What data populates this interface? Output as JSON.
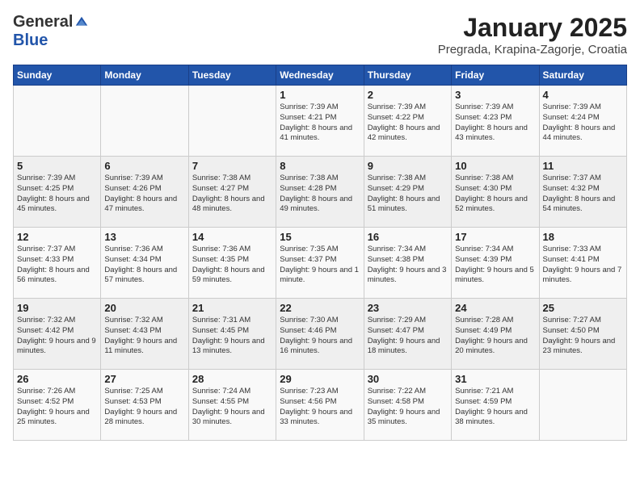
{
  "header": {
    "logo_general": "General",
    "logo_blue": "Blue",
    "month": "January 2025",
    "location": "Pregrada, Krapina-Zagorje, Croatia"
  },
  "days_of_week": [
    "Sunday",
    "Monday",
    "Tuesday",
    "Wednesday",
    "Thursday",
    "Friday",
    "Saturday"
  ],
  "weeks": [
    [
      {
        "day": "",
        "info": ""
      },
      {
        "day": "",
        "info": ""
      },
      {
        "day": "",
        "info": ""
      },
      {
        "day": "1",
        "info": "Sunrise: 7:39 AM\nSunset: 4:21 PM\nDaylight: 8 hours and 41 minutes."
      },
      {
        "day": "2",
        "info": "Sunrise: 7:39 AM\nSunset: 4:22 PM\nDaylight: 8 hours and 42 minutes."
      },
      {
        "day": "3",
        "info": "Sunrise: 7:39 AM\nSunset: 4:23 PM\nDaylight: 8 hours and 43 minutes."
      },
      {
        "day": "4",
        "info": "Sunrise: 7:39 AM\nSunset: 4:24 PM\nDaylight: 8 hours and 44 minutes."
      }
    ],
    [
      {
        "day": "5",
        "info": "Sunrise: 7:39 AM\nSunset: 4:25 PM\nDaylight: 8 hours and 45 minutes."
      },
      {
        "day": "6",
        "info": "Sunrise: 7:39 AM\nSunset: 4:26 PM\nDaylight: 8 hours and 47 minutes."
      },
      {
        "day": "7",
        "info": "Sunrise: 7:38 AM\nSunset: 4:27 PM\nDaylight: 8 hours and 48 minutes."
      },
      {
        "day": "8",
        "info": "Sunrise: 7:38 AM\nSunset: 4:28 PM\nDaylight: 8 hours and 49 minutes."
      },
      {
        "day": "9",
        "info": "Sunrise: 7:38 AM\nSunset: 4:29 PM\nDaylight: 8 hours and 51 minutes."
      },
      {
        "day": "10",
        "info": "Sunrise: 7:38 AM\nSunset: 4:30 PM\nDaylight: 8 hours and 52 minutes."
      },
      {
        "day": "11",
        "info": "Sunrise: 7:37 AM\nSunset: 4:32 PM\nDaylight: 8 hours and 54 minutes."
      }
    ],
    [
      {
        "day": "12",
        "info": "Sunrise: 7:37 AM\nSunset: 4:33 PM\nDaylight: 8 hours and 56 minutes."
      },
      {
        "day": "13",
        "info": "Sunrise: 7:36 AM\nSunset: 4:34 PM\nDaylight: 8 hours and 57 minutes."
      },
      {
        "day": "14",
        "info": "Sunrise: 7:36 AM\nSunset: 4:35 PM\nDaylight: 8 hours and 59 minutes."
      },
      {
        "day": "15",
        "info": "Sunrise: 7:35 AM\nSunset: 4:37 PM\nDaylight: 9 hours and 1 minute."
      },
      {
        "day": "16",
        "info": "Sunrise: 7:34 AM\nSunset: 4:38 PM\nDaylight: 9 hours and 3 minutes."
      },
      {
        "day": "17",
        "info": "Sunrise: 7:34 AM\nSunset: 4:39 PM\nDaylight: 9 hours and 5 minutes."
      },
      {
        "day": "18",
        "info": "Sunrise: 7:33 AM\nSunset: 4:41 PM\nDaylight: 9 hours and 7 minutes."
      }
    ],
    [
      {
        "day": "19",
        "info": "Sunrise: 7:32 AM\nSunset: 4:42 PM\nDaylight: 9 hours and 9 minutes."
      },
      {
        "day": "20",
        "info": "Sunrise: 7:32 AM\nSunset: 4:43 PM\nDaylight: 9 hours and 11 minutes."
      },
      {
        "day": "21",
        "info": "Sunrise: 7:31 AM\nSunset: 4:45 PM\nDaylight: 9 hours and 13 minutes."
      },
      {
        "day": "22",
        "info": "Sunrise: 7:30 AM\nSunset: 4:46 PM\nDaylight: 9 hours and 16 minutes."
      },
      {
        "day": "23",
        "info": "Sunrise: 7:29 AM\nSunset: 4:47 PM\nDaylight: 9 hours and 18 minutes."
      },
      {
        "day": "24",
        "info": "Sunrise: 7:28 AM\nSunset: 4:49 PM\nDaylight: 9 hours and 20 minutes."
      },
      {
        "day": "25",
        "info": "Sunrise: 7:27 AM\nSunset: 4:50 PM\nDaylight: 9 hours and 23 minutes."
      }
    ],
    [
      {
        "day": "26",
        "info": "Sunrise: 7:26 AM\nSunset: 4:52 PM\nDaylight: 9 hours and 25 minutes."
      },
      {
        "day": "27",
        "info": "Sunrise: 7:25 AM\nSunset: 4:53 PM\nDaylight: 9 hours and 28 minutes."
      },
      {
        "day": "28",
        "info": "Sunrise: 7:24 AM\nSunset: 4:55 PM\nDaylight: 9 hours and 30 minutes."
      },
      {
        "day": "29",
        "info": "Sunrise: 7:23 AM\nSunset: 4:56 PM\nDaylight: 9 hours and 33 minutes."
      },
      {
        "day": "30",
        "info": "Sunrise: 7:22 AM\nSunset: 4:58 PM\nDaylight: 9 hours and 35 minutes."
      },
      {
        "day": "31",
        "info": "Sunrise: 7:21 AM\nSunset: 4:59 PM\nDaylight: 9 hours and 38 minutes."
      },
      {
        "day": "",
        "info": ""
      }
    ]
  ]
}
